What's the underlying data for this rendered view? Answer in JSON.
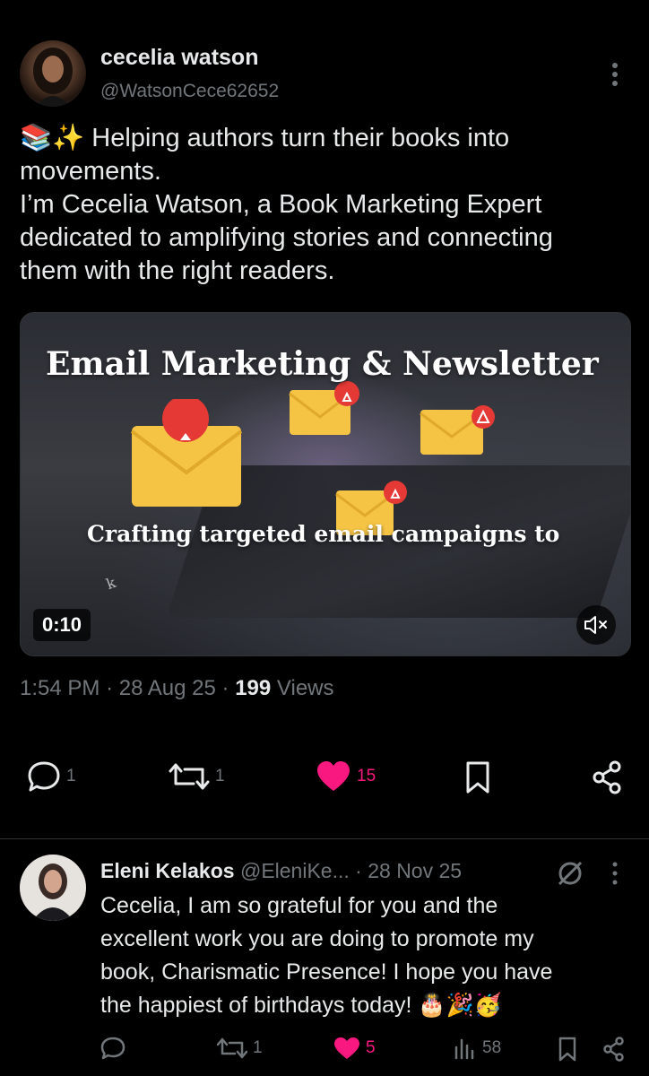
{
  "post": {
    "author_name": "cecelia watson",
    "author_handle": "@WatsonCece62652",
    "text_lines": [
      "📚✨ Helping authors turn their books into",
      "movements.",
      "I’m Cecelia Watson, a Book Marketing Expert",
      "dedicated to amplifying stories and connecting",
      "them with the right readers."
    ],
    "video": {
      "title": "Email Marketing & Newsletter",
      "subtitle": "Crafting targeted email campaigns to",
      "duration": "0:10",
      "watermark": "k",
      "mute_icon": "speaker-muted-icon"
    },
    "time": "1:54 PM",
    "date": "28 Aug 25",
    "views_count": "199",
    "views_label": "Views",
    "actions": {
      "replies": "1",
      "reposts": "1",
      "likes": "15"
    }
  },
  "reply": {
    "author_name": "Eleni Kelakos",
    "author_handle": "@EleniKe...",
    "date": "28 Nov 25",
    "text_lines": [
      "Cecelia, I am so grateful for you and the",
      "excellent work you are doing to promote my",
      "book, Charismatic Presence! I hope you have",
      "the happiest of birthdays today! 🎂🎉🥳"
    ],
    "actions": {
      "replies": "",
      "reposts": "1",
      "likes": "5",
      "views": "58"
    }
  },
  "colors": {
    "background": "#000000",
    "text": "#e7e9ea",
    "muted": "#71767b",
    "like": "#f91880",
    "envelope": "#f6c445",
    "badge": "#e53935"
  }
}
